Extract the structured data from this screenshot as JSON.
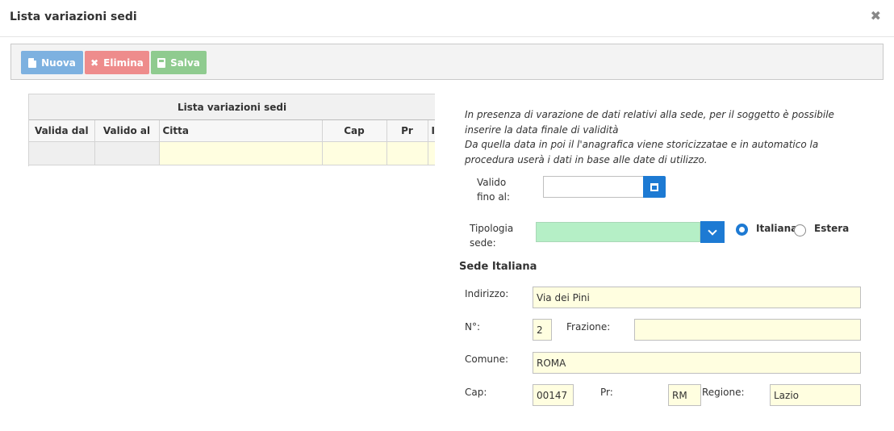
{
  "dialog": {
    "title": "Lista variazioni sedi",
    "close_glyph": "✖"
  },
  "toolbar": {
    "nuova_label": "Nuova",
    "elimina_label": "Elimina",
    "salva_label": "Salva"
  },
  "grid": {
    "caption": "Lista variazioni sedi",
    "columns": [
      "Valida dal",
      "Valido al",
      "Citta",
      "Cap",
      "Pr",
      "In"
    ]
  },
  "info": {
    "line1": "In presenza di varazione de dati relativi alla sede, per il soggetto è possibile inserire la data finale di validità",
    "line2": "Da quella data in poi il l'anagrafica viene storicizzatae e in automatico la procedura userà i dati in base alle date di utilizzo."
  },
  "form": {
    "valido_label_1": "Valido",
    "valido_label_2": "fino al:",
    "valido_value": "",
    "tipologia_label_1": "Tipologia",
    "tipologia_label_2": "sede:",
    "tipologia_value": "",
    "radio_italiana": "Italiana",
    "radio_estera": "Estera",
    "radio_selected": "Italiana",
    "section_title": "Sede Italiana",
    "indirizzo_label": "Indirizzo:",
    "indirizzo_value": "Via dei Pini",
    "numero_label": "N°:",
    "numero_value": "2",
    "frazione_label": "Frazione:",
    "frazione_value": "",
    "comune_label": "Comune:",
    "comune_value": "ROMA",
    "cap_label": "Cap:",
    "cap_value": "00147",
    "pr_label": "Pr:",
    "pr_value": "RM",
    "regione_label": "Regione:",
    "regione_value": "Lazio"
  },
  "colors": {
    "primary": "#1d7ad3",
    "nuova": "#7db1e0",
    "elimina": "#ee8c8c",
    "salva": "#8fcb8f",
    "select_bg": "#b5efc6",
    "field_bg": "#fffee0"
  }
}
